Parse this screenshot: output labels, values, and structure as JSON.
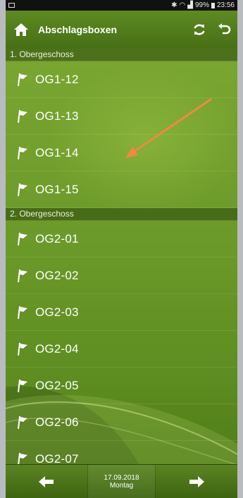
{
  "status_bar": {
    "icons": [
      "bluetooth-icon",
      "wifi-icon",
      "signal-icon",
      "battery-icon"
    ],
    "battery": "99%",
    "time": "23:56"
  },
  "header": {
    "title": "Abschlagsboxen",
    "home_icon": "home-icon",
    "refresh_icon": "refresh-icon",
    "back_icon": "back-icon"
  },
  "sections": [
    {
      "title": "1. Obergeschoss",
      "items": [
        "OG1-12",
        "OG1-13",
        "OG1-14",
        "OG1-15"
      ]
    },
    {
      "title": "2. Obergeschoss",
      "items": [
        "OG2-01",
        "OG2-02",
        "OG2-03",
        "OG2-04",
        "OG2-05",
        "OG2-06",
        "OG2-07"
      ]
    }
  ],
  "item_icon": "golf-flag-icon",
  "footer": {
    "date": "17.09.2018",
    "day": "Montag",
    "prev_icon": "arrow-left-icon",
    "next_icon": "arrow-right-icon"
  },
  "colors": {
    "header_green": "#4e7a1a",
    "content_green": "#6c9a2a",
    "annotation_arrow": "#f08a3c"
  }
}
